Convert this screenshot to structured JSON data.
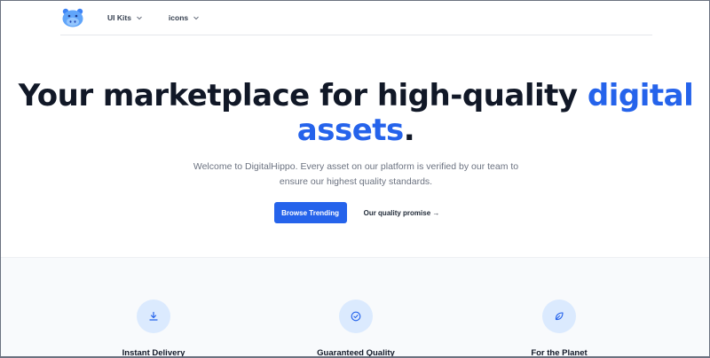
{
  "nav": {
    "items": [
      {
        "label": "UI Kits"
      },
      {
        "label": "icons"
      }
    ]
  },
  "hero": {
    "title_part1": "Your marketplace for high-quality ",
    "title_accent": "digital assets",
    "title_end": ".",
    "lead": "Welcome to DigitalHippo. Every asset on our platform is verified by our team to ensure our highest quality standards.",
    "primary_cta": "Browse Trending",
    "secondary_cta": "Our quality promise →"
  },
  "features": [
    {
      "title": "Instant Delivery",
      "icon": "download-icon"
    },
    {
      "title": "Guaranteed Quality",
      "icon": "check-circle-icon"
    },
    {
      "title": "For the Planet",
      "icon": "leaf-icon"
    }
  ],
  "colors": {
    "accent": "#2563eb",
    "icon_bg": "#dbeafe",
    "section_bg": "#f8fafc"
  }
}
